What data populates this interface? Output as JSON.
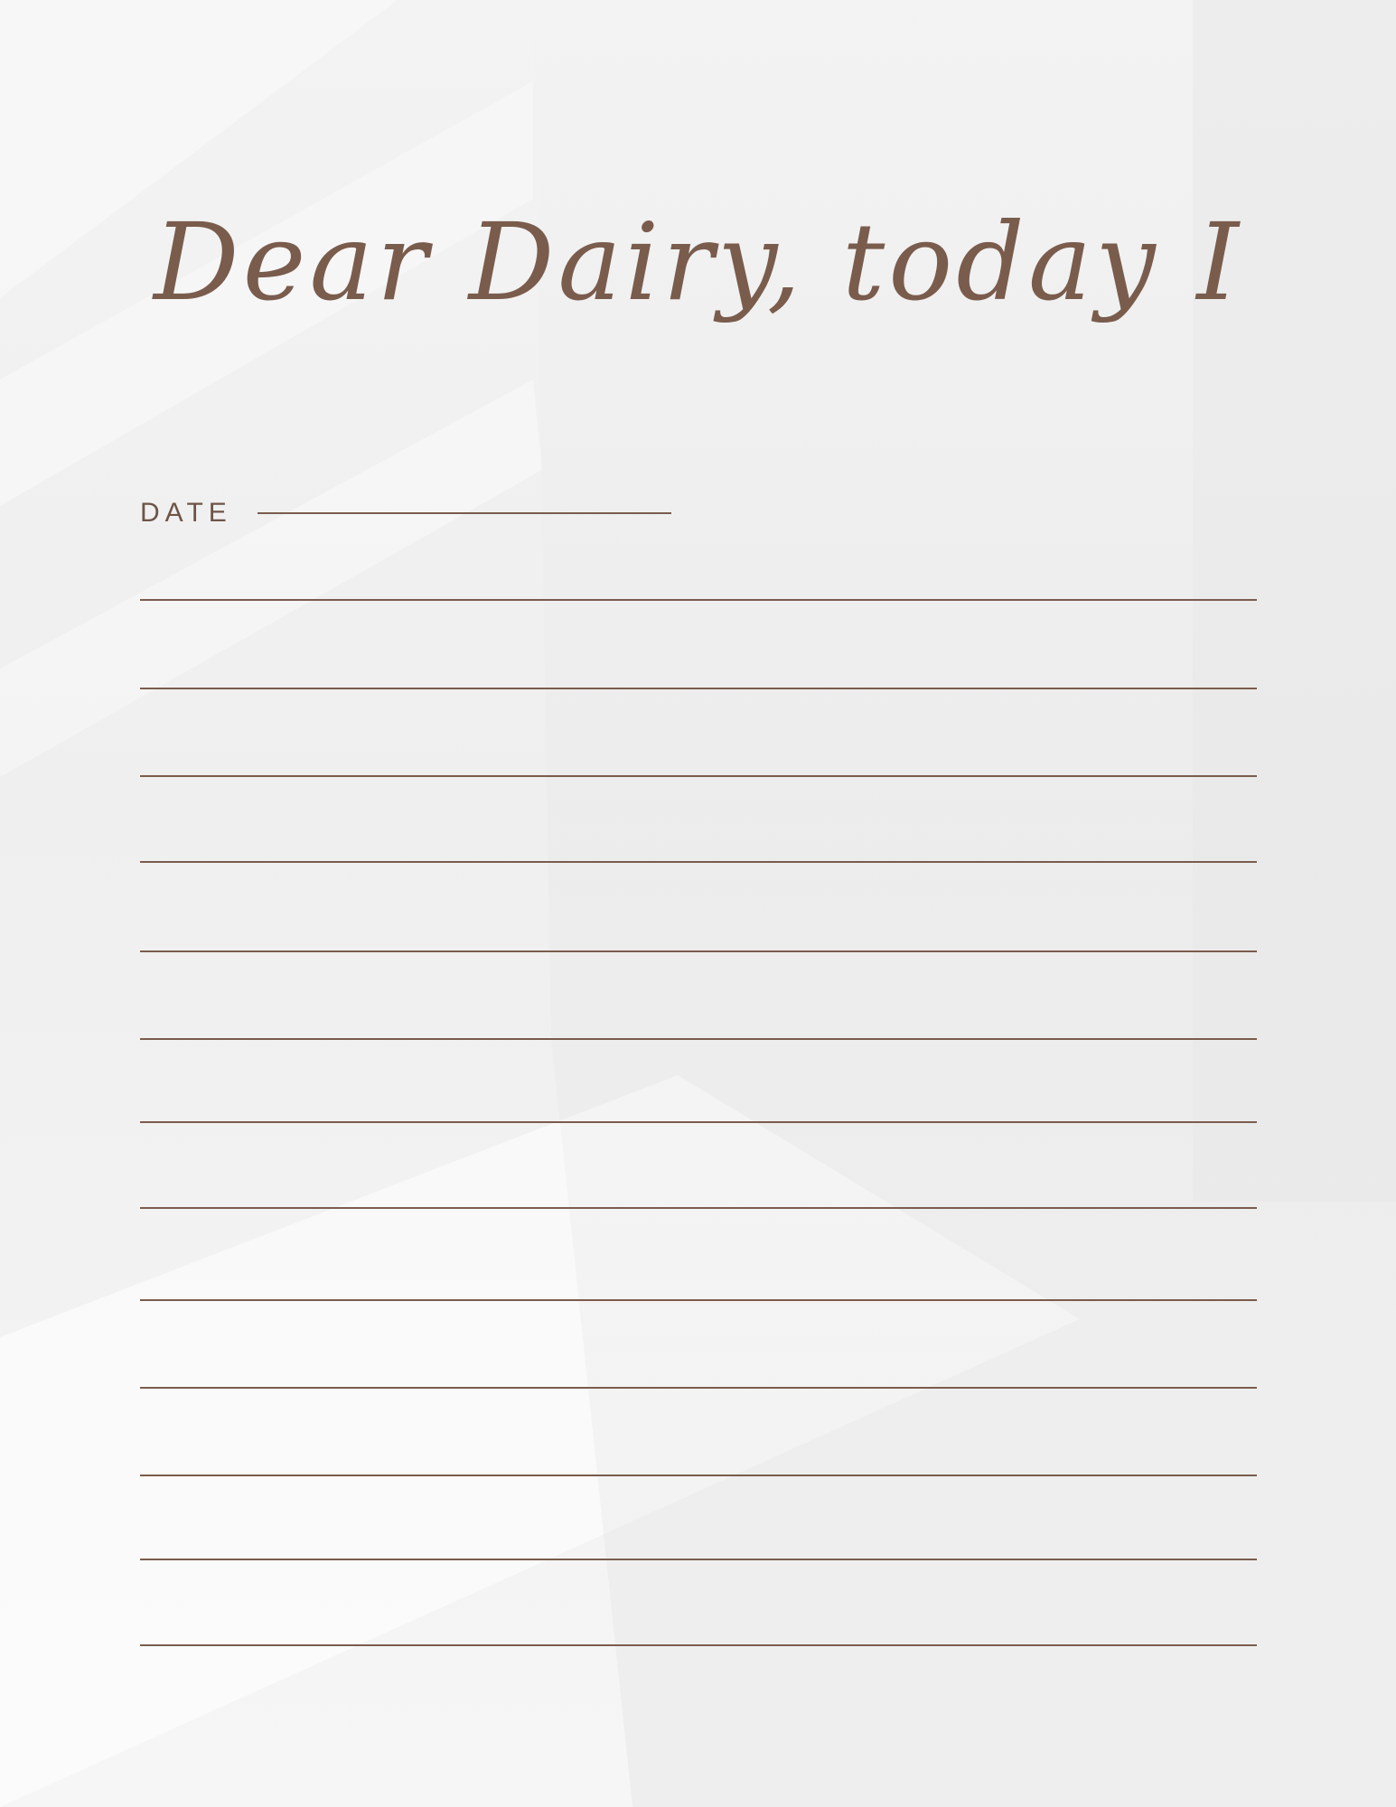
{
  "header": {
    "title": "Dear Dairy, today I"
  },
  "date_field": {
    "label": "DATE",
    "value": ""
  },
  "writing_lines": {
    "count": 13,
    "color": "#7a5c4d"
  },
  "colors": {
    "ink": "#7a5c4d",
    "paper": "#efefef"
  }
}
